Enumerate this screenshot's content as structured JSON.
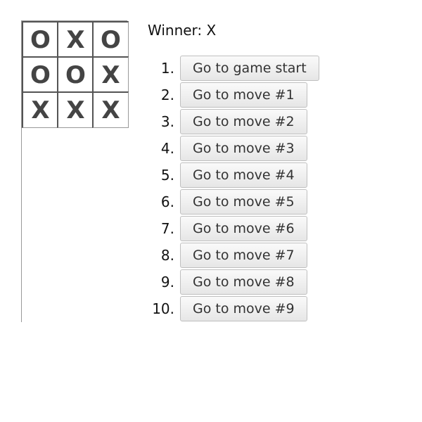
{
  "board": {
    "squares": [
      "O",
      "X",
      "O",
      "O",
      "O",
      "X",
      "X",
      "X",
      "X"
    ]
  },
  "status": "Winner: X",
  "moves": [
    {
      "num": "1.",
      "label": "Go to game start"
    },
    {
      "num": "2.",
      "label": "Go to move #1"
    },
    {
      "num": "3.",
      "label": "Go to move #2"
    },
    {
      "num": "4.",
      "label": "Go to move #3"
    },
    {
      "num": "5.",
      "label": "Go to move #4"
    },
    {
      "num": "6.",
      "label": "Go to move #5"
    },
    {
      "num": "7.",
      "label": "Go to move #6"
    },
    {
      "num": "8.",
      "label": "Go to move #7"
    },
    {
      "num": "9.",
      "label": "Go to move #8"
    },
    {
      "num": "10.",
      "label": "Go to move #9"
    }
  ]
}
